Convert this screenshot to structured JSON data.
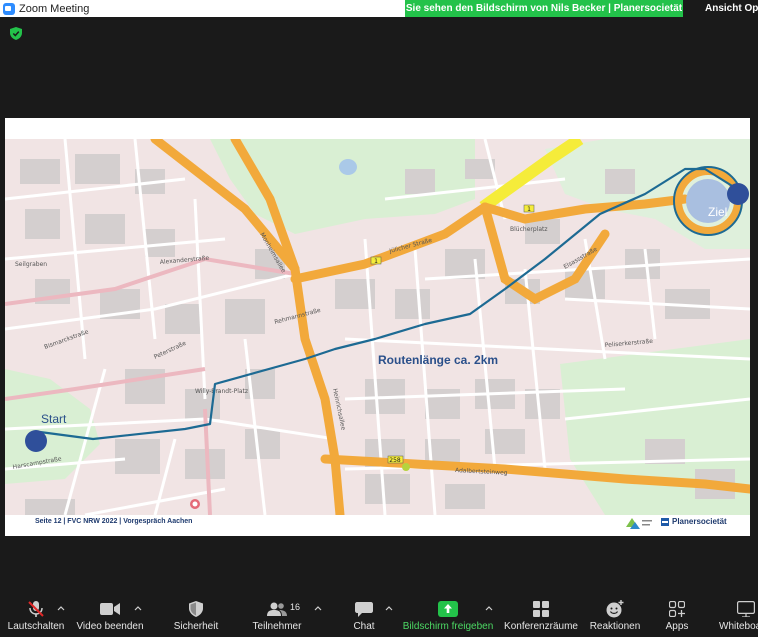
{
  "window": {
    "title": "Zoom Meeting"
  },
  "share_banner": "Sie sehen den Bildschirm von Nils Becker | Planersocietät",
  "view_options": "Ansicht Optionen",
  "slide": {
    "footer": "Seite 12   | FVC NRW 2022 | Vorgespräch Aachen",
    "brand": "Planersocietät",
    "map": {
      "start_label": "Start",
      "end_label": "Ziel",
      "route_length": "Routenlänge ca. 2km",
      "streets": {
        "juelicher": "Jülicher Straße",
        "adalbertsteinweg": "Adalbertsteinweg",
        "bluecherplatz": "Blücherplatz",
        "heinrichsallee": "Heinrichsallee",
        "monheimsallee": "Monheimsallee",
        "alexanderstrasse": "Alexanderstraße",
        "peterstrasse": "Peterstraße",
        "willy_brandt_platz": "Willy-Brandt-Platz",
        "seilgraben": "Seilgraben",
        "harscampstrasse": "Harscampstraße",
        "bismarckstrasse": "Bismarckstraße",
        "elsassstrasse": "Elsassstraße",
        "peliserkerstrasse": "Peliserkerstraße",
        "rehmannstrasse": "Rehmannstraße",
        "road_1": "1",
        "road_258": "258"
      }
    }
  },
  "toolbar": {
    "mute": "Lautschalten",
    "video": "Video beenden",
    "security": "Sicherheit",
    "participants": "Teilnehmer",
    "participants_count": "16",
    "chat": "Chat",
    "share": "Bildschirm freigeben",
    "breakout": "Konferenzräume",
    "reactions": "Reaktionen",
    "apps": "Apps",
    "whiteboard": "Whiteboards"
  },
  "colors": {
    "share_green": "#23c24a",
    "route_blue": "#1d6a93",
    "marker_blue": "#2f4f9a",
    "major_road": "#f2a93b",
    "motorway_yellow": "#f5ec3a"
  }
}
